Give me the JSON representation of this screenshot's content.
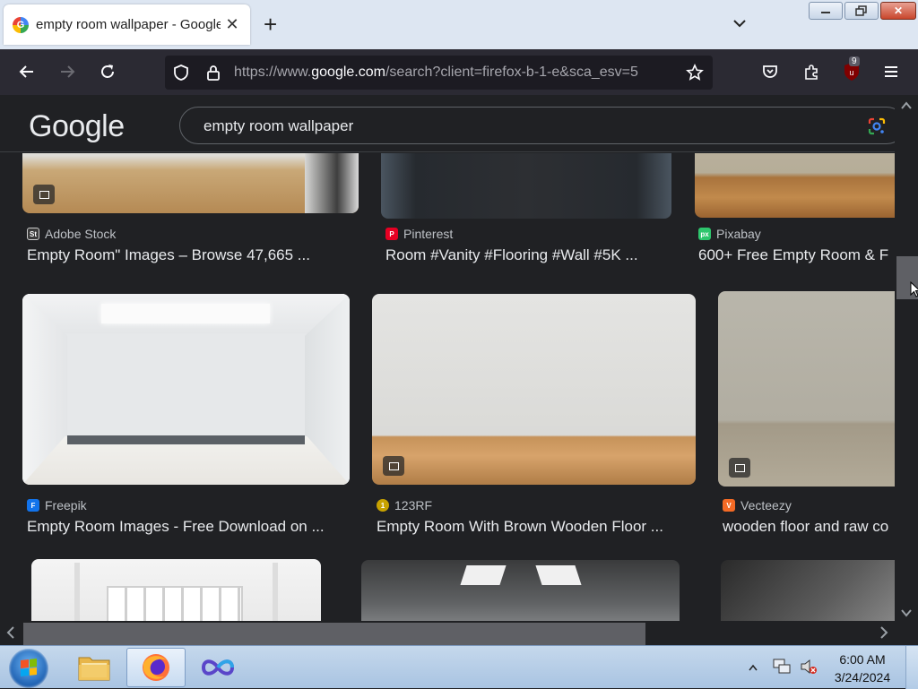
{
  "browser": {
    "tab_title": "empty room wallpaper - Google",
    "tab_favicon": "G",
    "url_prefix": "https://www.",
    "url_domain": "google.com",
    "url_rest": "/search?client=firefox-b-1-e&sca_esv=5",
    "extension_badge": "9",
    "icons": [
      "back-icon",
      "forward-icon",
      "reload-icon",
      "shield-icon",
      "lock-icon",
      "bookmark-star-icon",
      "pocket-icon",
      "extensions-icon",
      "ublock-icon",
      "menu-icon"
    ]
  },
  "google": {
    "logo": "Google",
    "query": "empty room wallpaper"
  },
  "results": {
    "row1": [
      {
        "source": "Adobe Stock",
        "source_icon": "St",
        "icon_color": "#3b3b3b",
        "title": "Empty Room\" Images – Browse 47,665 ..."
      },
      {
        "source": "Pinterest",
        "source_icon": "P",
        "icon_color": "#e60023",
        "title": "Room #Vanity #Flooring #Wall #5K ..."
      },
      {
        "source": "Pixabay",
        "source_icon": "px",
        "icon_color": "#2ec66d",
        "title": "600+ Free Empty Room & F"
      }
    ],
    "row2": [
      {
        "source": "Freepik",
        "source_icon": "F",
        "icon_color": "#1273eb",
        "title": "Empty Room Images - Free Download on ..."
      },
      {
        "source": "123RF",
        "source_icon": "1",
        "icon_color": "#c8a200",
        "title": "Empty Room With Brown Wooden Floor ..."
      },
      {
        "source": "Vecteezy",
        "source_icon": "V",
        "icon_color": "#f46a25",
        "title": "wooden floor and raw co"
      }
    ]
  },
  "taskbar": {
    "time": "6:00 AM",
    "date": "3/24/2024",
    "items": [
      "file-explorer",
      "firefox",
      "visual-studio"
    ]
  }
}
